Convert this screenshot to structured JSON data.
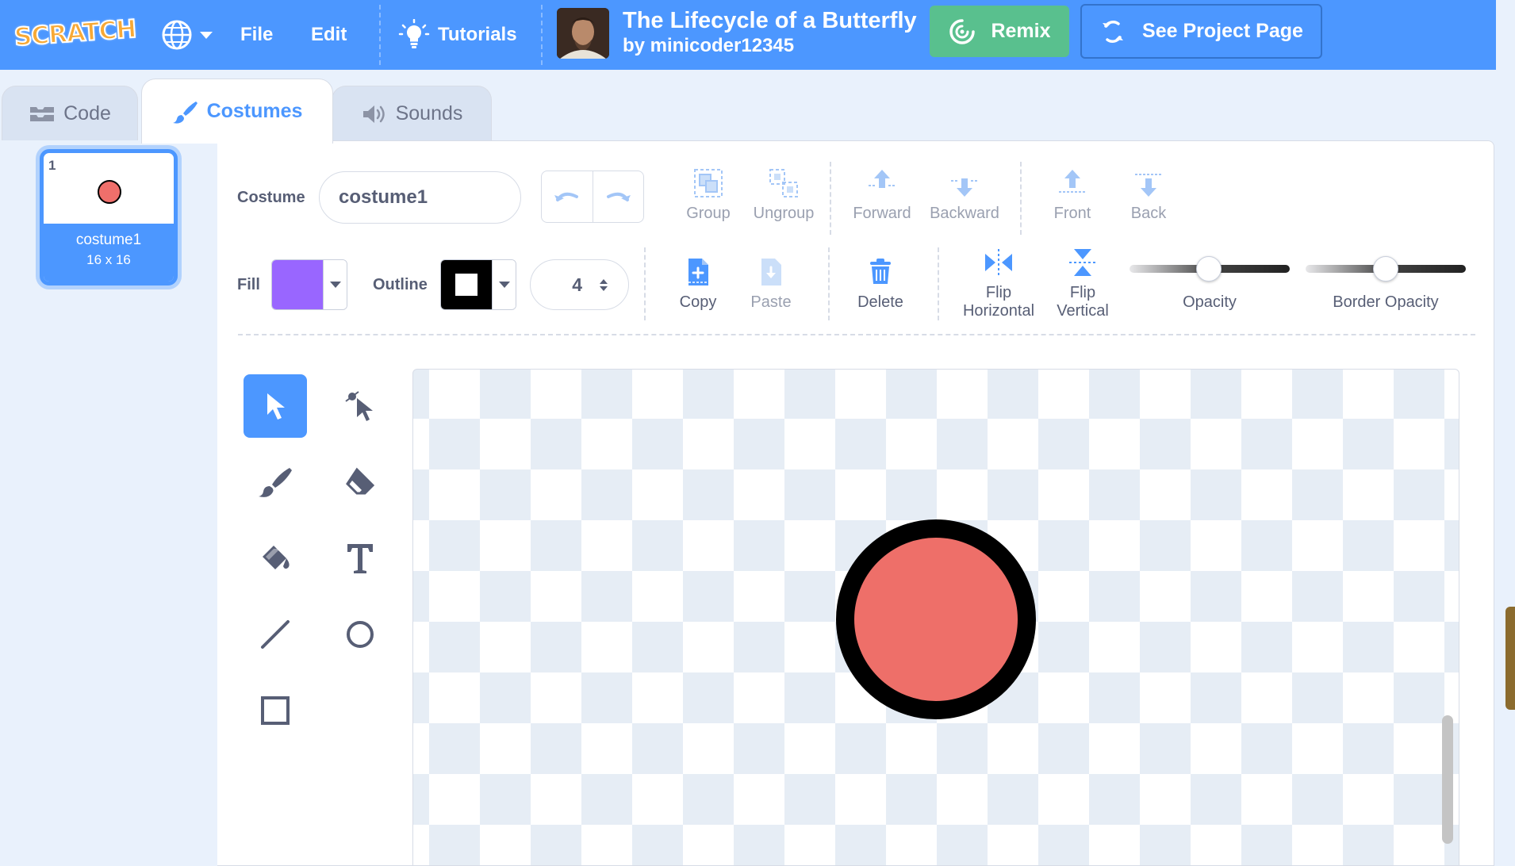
{
  "menu": {
    "logo": "SCRATCH",
    "file": "File",
    "edit": "Edit",
    "tutorials": "Tutorials",
    "project_title": "The Lifecycle of a Butterfly",
    "project_author": "by minicoder12345",
    "remix": "Remix",
    "see_project": "See Project Page"
  },
  "tabs": {
    "code": "Code",
    "costumes": "Costumes",
    "sounds": "Sounds"
  },
  "costume_list": [
    {
      "number": "1",
      "name": "costume1",
      "size": "16 x 16"
    }
  ],
  "editor": {
    "costume_label": "Costume",
    "costume_name": "costume1",
    "group": "Group",
    "ungroup": "Ungroup",
    "forward": "Forward",
    "backward": "Backward",
    "front": "Front",
    "back": "Back",
    "fill_label": "Fill",
    "outline_label": "Outline",
    "outline_width": "4",
    "copy": "Copy",
    "paste": "Paste",
    "delete": "Delete",
    "flip_h_1": "Flip",
    "flip_h_2": "Horizontal",
    "flip_v_1": "Flip",
    "flip_v_2": "Vertical",
    "opacity": "Opacity",
    "border_opacity": "Border Opacity"
  },
  "colors": {
    "accent": "#4c97ff",
    "remix": "#59c08e",
    "fill": "#9966ff",
    "outline": "#000000",
    "shape_fill": "#ee6f69"
  }
}
